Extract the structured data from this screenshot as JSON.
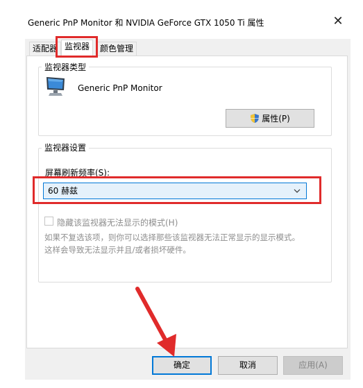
{
  "window": {
    "title": "Generic PnP Monitor 和 NVIDIA GeForce GTX 1050 Ti 属性",
    "close_label": "✕"
  },
  "tabs": [
    {
      "label": "适配器",
      "active": false
    },
    {
      "label": "监视器",
      "active": true
    },
    {
      "label": "颜色管理",
      "active": false
    }
  ],
  "monitor_type": {
    "group_label": "监视器类型",
    "device_name": "Generic PnP Monitor",
    "properties_button": "属性(P)",
    "icon": "monitor-icon"
  },
  "monitor_settings": {
    "group_label": "监视器设置",
    "refresh_rate_label": "屏幕刷新频率(S):",
    "refresh_rate_value": "60 赫兹",
    "hide_modes_label": "隐藏该监视器无法显示的模式(H)",
    "hide_modes_checked": false,
    "help_line1": "如果不复选该项，则你可以选择那些该监视器无法正常显示的显示模式。",
    "help_line2": "这样会导致无法显示并且/或者损坏硬件。"
  },
  "footer": {
    "ok": "确定",
    "cancel": "取消",
    "apply": "应用(A)"
  },
  "colors": {
    "highlight": "#e02b2b",
    "accent": "#0078d7",
    "combo_bg": "#e5f1fb"
  }
}
